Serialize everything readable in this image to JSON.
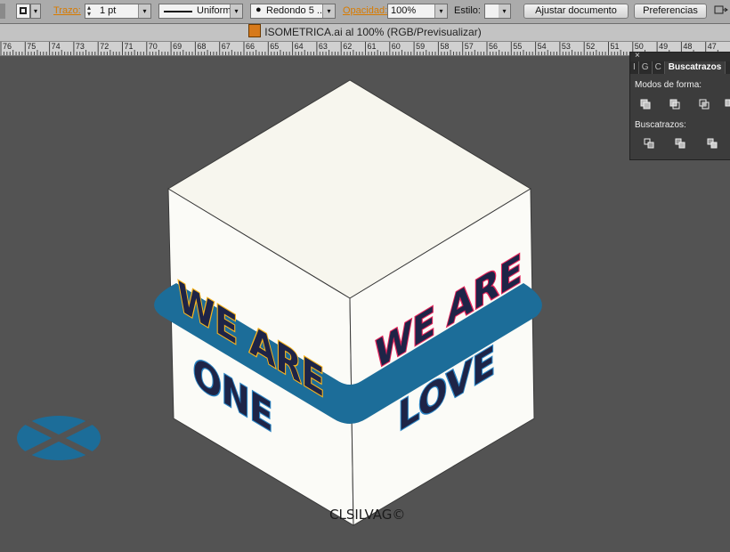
{
  "control_bar": {
    "stroke_label": "Trazo:",
    "stroke_weight": "1 pt",
    "profile_value": "Uniforme",
    "brush_value": "Redondo 5 ...",
    "opacity_label": "Opacidad:",
    "opacity_value": "100%",
    "style_label": "Estilo:",
    "document_setup_button": "Ajustar documento",
    "preferences_button": "Preferencias"
  },
  "document": {
    "title": "ISOMETRICA.ai al 100% (RGB/Previsualizar)"
  },
  "ruler": {
    "ticks": [
      "76",
      "75",
      "74",
      "73",
      "72",
      "71",
      "70",
      "69",
      "68",
      "67",
      "66",
      "65",
      "64",
      "63",
      "62",
      "61",
      "60",
      "59",
      "58",
      "57",
      "56",
      "55",
      "54",
      "53",
      "52",
      "51",
      "50",
      "49",
      "48",
      "47"
    ]
  },
  "artwork": {
    "left_face_line1": "WE ARE",
    "left_face_line2": "ONE",
    "right_face_line1": "WE ARE",
    "right_face_line2": "LOVE",
    "signature": "CLSILVAG©",
    "colors": {
      "face": "#f7f6ee",
      "band": "#1c6d99",
      "navy": "#1e2447",
      "pink": "#e4245a",
      "yellow": "#f7b41f",
      "blue": "#2a83c3",
      "canvas": "#535353"
    }
  },
  "pathfinder_panel": {
    "tabs": [
      "I",
      "G",
      "C",
      "Buscatrazos"
    ],
    "active_tab": "Buscatrazos",
    "shape_modes_label": "Modos de forma:",
    "pathfinders_label": "Buscatrazos:",
    "close_glyph": "×"
  },
  "icons": [
    "stroke-color-icon",
    "close-icon",
    "shape-mode-unite-icon",
    "shape-mode-minus-front-icon",
    "shape-mode-intersect-icon",
    "shape-mode-exclude-icon",
    "pathfinder-divide-icon",
    "pathfinder-trim-icon",
    "pathfinder-merge-icon",
    "arrange-documents-icon"
  ]
}
